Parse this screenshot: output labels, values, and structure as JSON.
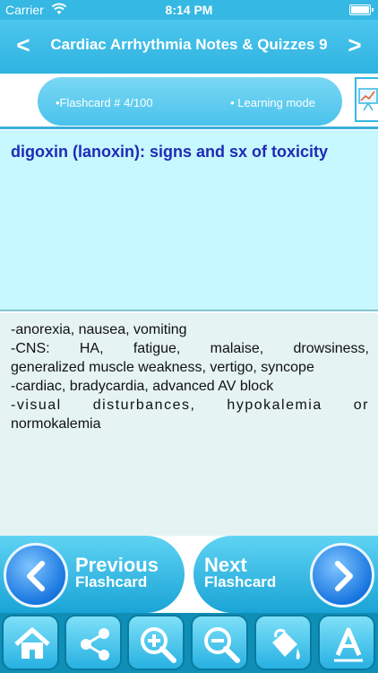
{
  "status_bar": {
    "carrier": "Carrier",
    "time": "8:14 PM"
  },
  "header": {
    "title": "Cardiac Arrhythmia Notes & Quizzes 9",
    "prev_glyph": "<",
    "next_glyph": ">"
  },
  "banner": {
    "flashcard_label": "•Flashcard #  4/100",
    "mode_label": "• Learning mode",
    "chart_icon": "chart-icon"
  },
  "question": {
    "text": "digoxin (lanoxin): signs and sx of toxicity"
  },
  "answer": {
    "lines": [
      "-anorexia, nausea, vomiting",
      "-CNS: HA, fatigue, malaise, drowsiness,",
      "generalized muscle weakness, vertigo, syncope",
      "-cardiac, bradycardia, advanced AV block",
      "-visual disturbances, hypokalemia or",
      "normokalemia"
    ]
  },
  "flashcard_nav": {
    "prev": {
      "line1": "Previous",
      "line2": "Flashcard",
      "icon": "chevron-left-icon"
    },
    "next": {
      "line1": "Next",
      "line2": "Flashcard",
      "icon": "chevron-right-icon"
    }
  },
  "toolbar": {
    "items": [
      "home-icon",
      "share-icon",
      "zoom-in-icon",
      "zoom-out-icon",
      "paint-bucket-icon",
      "font-icon"
    ]
  },
  "colors": {
    "accent": "#35b8e3",
    "question_bg": "#c7f7ff",
    "question_text": "#1e2bb5",
    "answer_bg": "#e5f3f3",
    "toolbar_bg": "#0f8fb6"
  }
}
